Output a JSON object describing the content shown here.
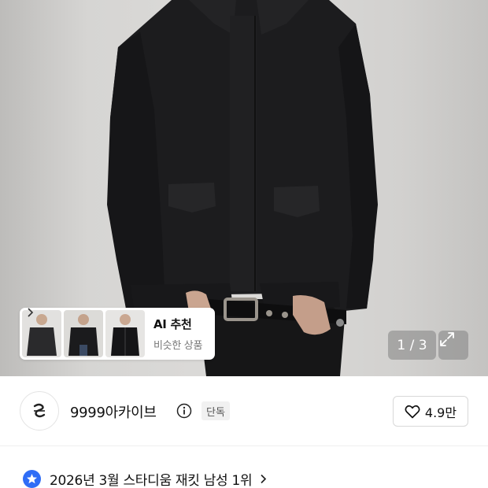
{
  "product": {
    "image_alt": "product-photo",
    "page_indicator": "1 / 3"
  },
  "ai_recommend": {
    "title": "AI 추천",
    "subtitle": "비슷한 상품"
  },
  "brand": {
    "name": "9999아카이브",
    "badge": "단독"
  },
  "like": {
    "count": "4.9만"
  },
  "ranking": {
    "text": "2026년 3월 스타디움 재킷 남성 1위"
  },
  "colors": {
    "rank_badge": "#2f6df6",
    "jacket": "#1c1c1e"
  }
}
